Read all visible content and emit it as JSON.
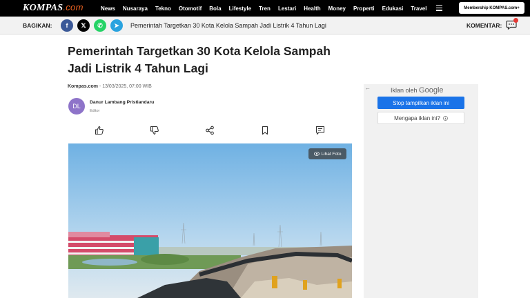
{
  "header": {
    "logo_main": "KOMPAS",
    "logo_suffix": ".com",
    "nav": [
      "News",
      "Nusaraya",
      "Tekno",
      "Otomotif",
      "Bola",
      "Lifestyle",
      "Tren",
      "Lestari",
      "Health",
      "Money",
      "Properti",
      "Edukasi",
      "Travel"
    ],
    "menu_icon": "hamburger-icon",
    "membership_label": "Membership KOMPAS.com+"
  },
  "sharebar": {
    "label": "BAGIKAN:",
    "networks": [
      {
        "name": "facebook",
        "glyph": "f",
        "color": "#3b5998"
      },
      {
        "name": "x",
        "glyph": "𝕏",
        "color": "#000000"
      },
      {
        "name": "whatsapp",
        "glyph": "✆",
        "color": "#25d366"
      },
      {
        "name": "telegram",
        "glyph": "➤",
        "color": "#2aa3df"
      }
    ],
    "title": "Pemerintah Targetkan 30 Kota Kelola Sampah Jadi Listrik 4 Tahun Lagi",
    "comment_label": "KOMENTAR:",
    "comment_icon": "comment-bubble-icon",
    "badge_color": "#e53935"
  },
  "article": {
    "headline": "Pemerintah Targetkan 30 Kota Kelola Sampah Jadi Listrik 4 Tahun Lagi",
    "source": "Kompas.com",
    "date": " - 13/03/2025, 07:00 WIB",
    "author_initials": "DL",
    "author_name": "Danur Lambang Pristiandaru",
    "author_role": "Editor",
    "actions": [
      "like-icon",
      "dislike-icon",
      "share-icon",
      "bookmark-icon",
      "comment-icon"
    ],
    "photo_button": "Lihat Foto"
  },
  "ad": {
    "by_label": "Iklan oleh",
    "brand": "Google",
    "stop_label": "Stop tampilkan iklan ini",
    "why_label": "Mengapa iklan ini?",
    "accent": "#1a73e8"
  }
}
